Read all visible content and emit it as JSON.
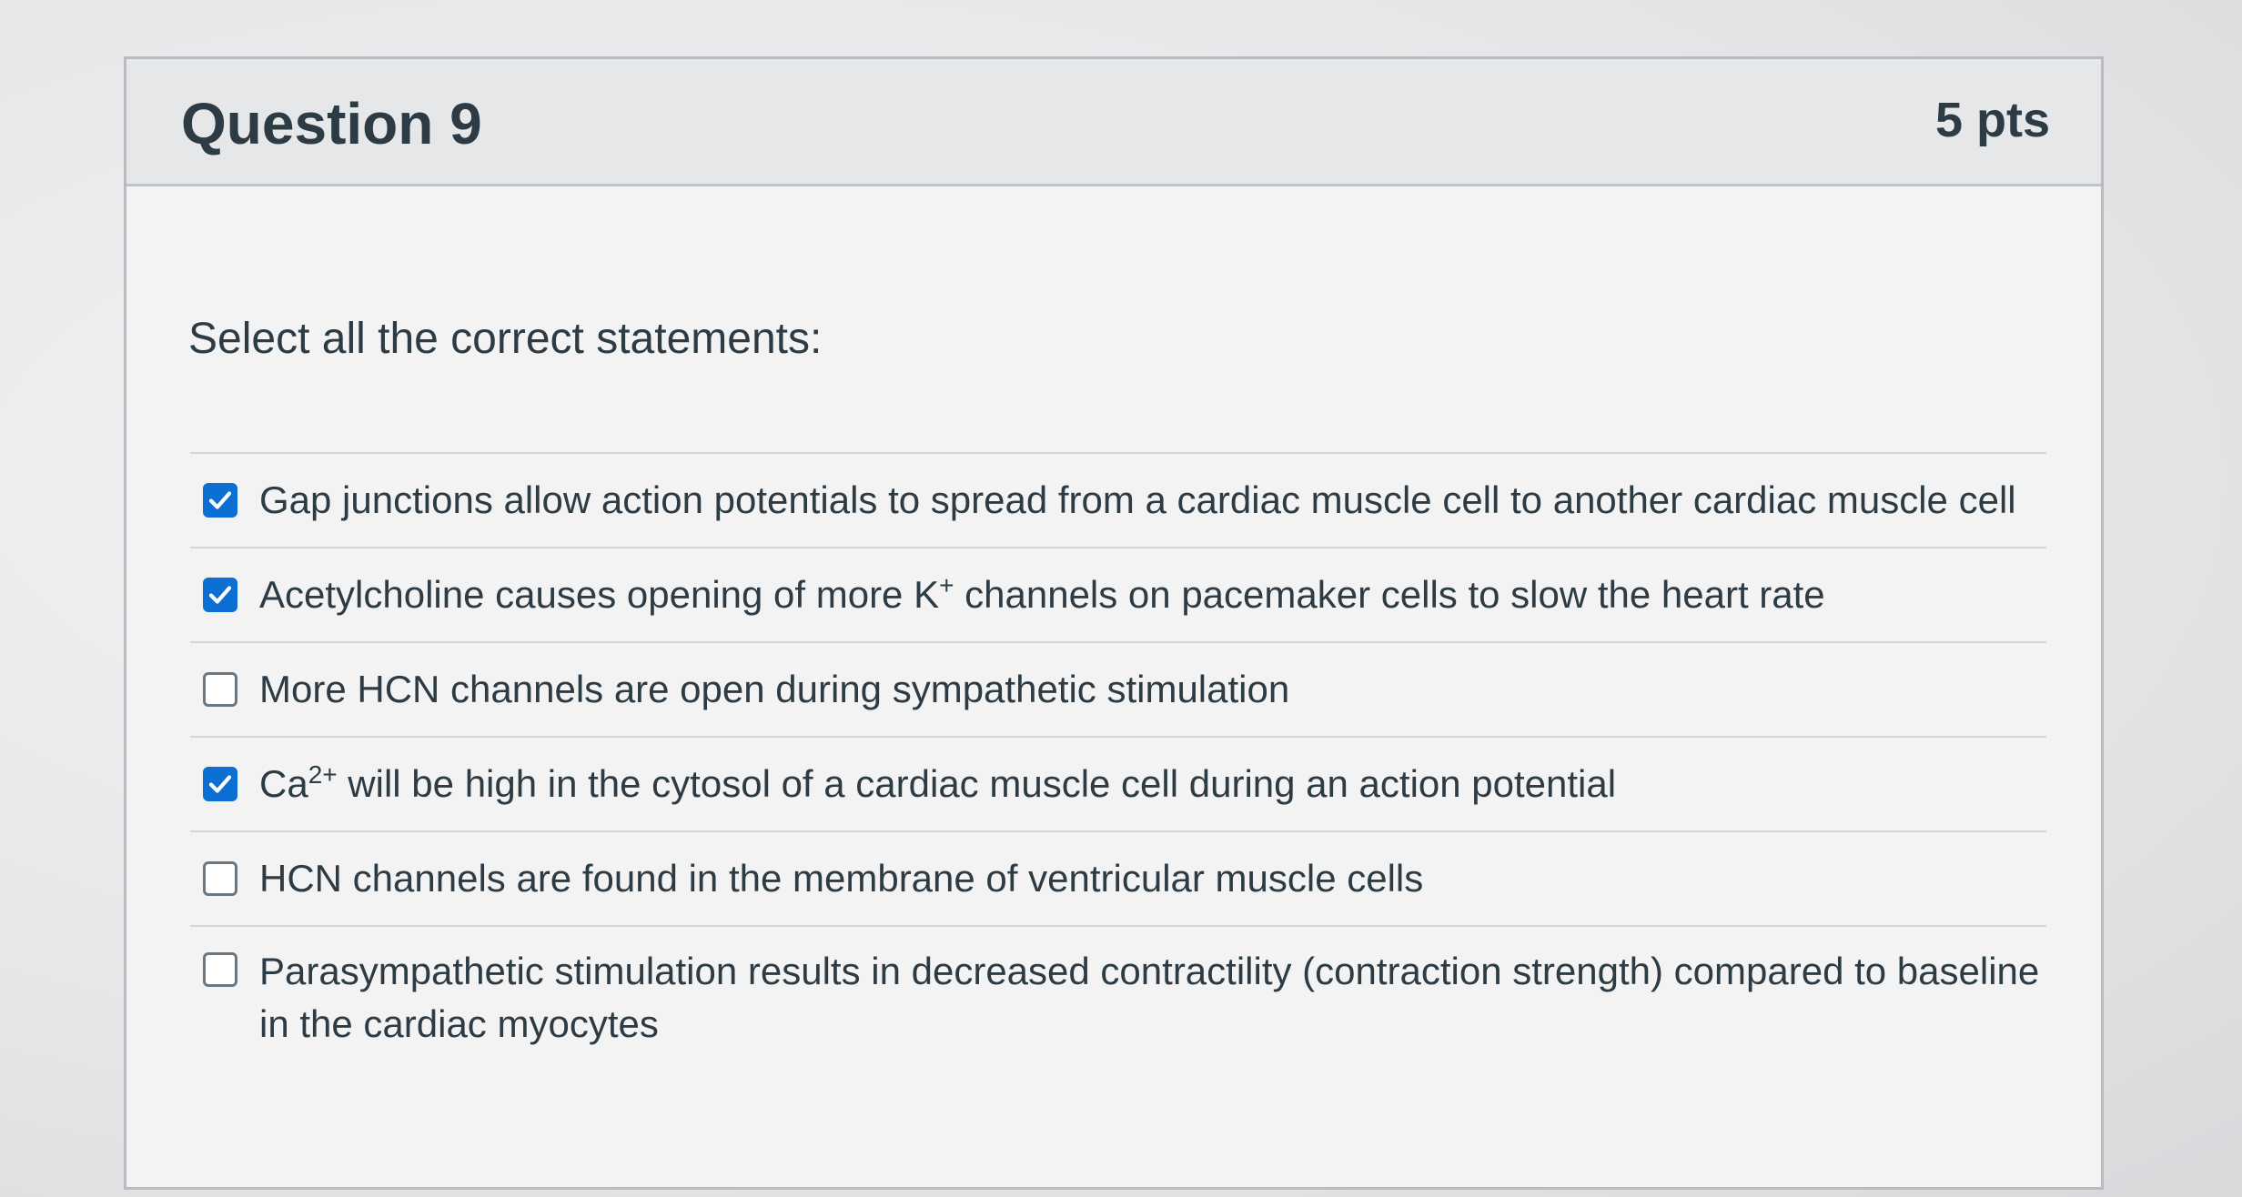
{
  "question": {
    "title": "Question 9",
    "points": "5 pts",
    "prompt": "Select all the correct statements:"
  },
  "answers": [
    {
      "text": "Gap junctions allow action potentials to spread from a cardiac muscle cell to another cardiac muscle cell",
      "checked": true
    },
    {
      "text_before": "Acetylcholine causes opening of more K",
      "superscript": "+",
      "text_after": " channels on pacemaker cells to slow the heart rate",
      "checked": true
    },
    {
      "text": "More HCN channels are open during sympathetic stimulation",
      "checked": false
    },
    {
      "text_before": "Ca",
      "superscript": "2+",
      "text_after": " will be high in the cytosol of a cardiac muscle cell during an action potential",
      "checked": true
    },
    {
      "text": "HCN channels are found in the membrane of ventricular muscle cells",
      "checked": false
    },
    {
      "text": "Parasympathetic stimulation results in decreased contractility (contraction strength) compared to baseline in the cardiac myocytes",
      "checked": false
    }
  ],
  "colors": {
    "checkbox_checked": "#0b6fd4",
    "text": "#2d3b45"
  },
  "icons": {
    "checked": "check-icon"
  }
}
